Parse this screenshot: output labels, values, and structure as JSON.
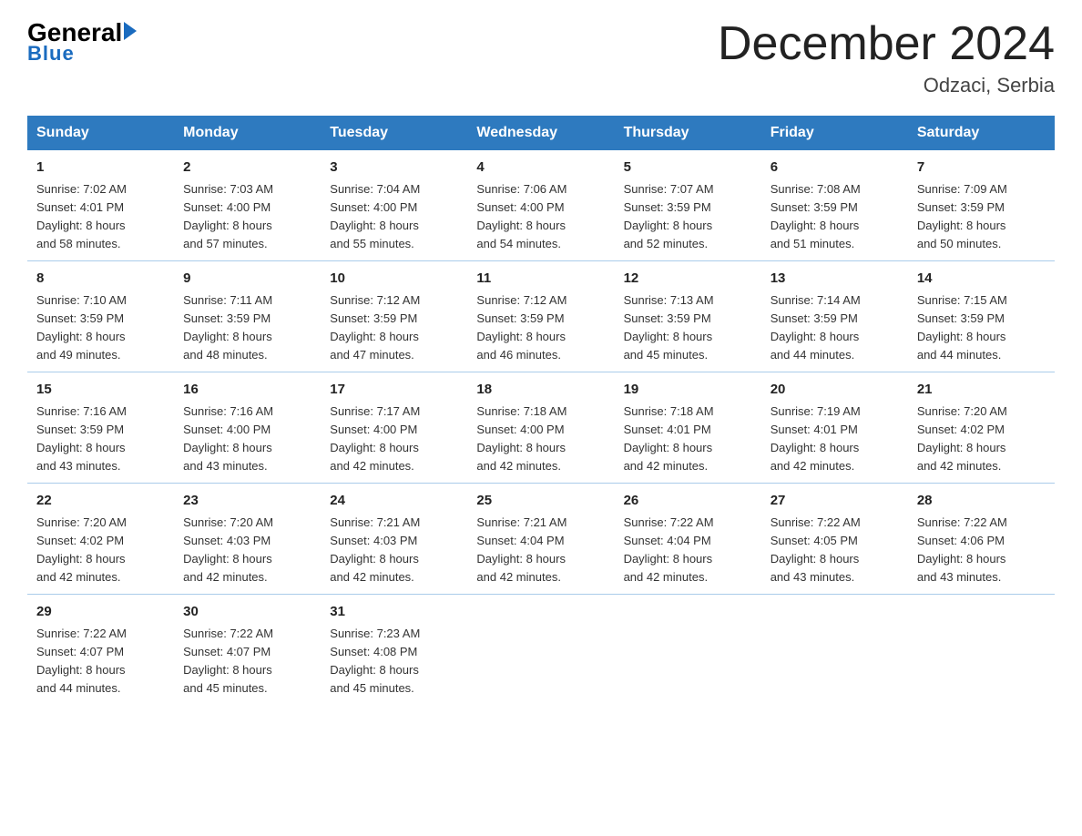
{
  "logo": {
    "general": "General",
    "blue": "Blue",
    "underline": "Blue"
  },
  "title": "December 2024",
  "subtitle": "Odzaci, Serbia",
  "header_days": [
    "Sunday",
    "Monday",
    "Tuesday",
    "Wednesday",
    "Thursday",
    "Friday",
    "Saturday"
  ],
  "weeks": [
    [
      {
        "num": "1",
        "info": "Sunrise: 7:02 AM\nSunset: 4:01 PM\nDaylight: 8 hours\nand 58 minutes."
      },
      {
        "num": "2",
        "info": "Sunrise: 7:03 AM\nSunset: 4:00 PM\nDaylight: 8 hours\nand 57 minutes."
      },
      {
        "num": "3",
        "info": "Sunrise: 7:04 AM\nSunset: 4:00 PM\nDaylight: 8 hours\nand 55 minutes."
      },
      {
        "num": "4",
        "info": "Sunrise: 7:06 AM\nSunset: 4:00 PM\nDaylight: 8 hours\nand 54 minutes."
      },
      {
        "num": "5",
        "info": "Sunrise: 7:07 AM\nSunset: 3:59 PM\nDaylight: 8 hours\nand 52 minutes."
      },
      {
        "num": "6",
        "info": "Sunrise: 7:08 AM\nSunset: 3:59 PM\nDaylight: 8 hours\nand 51 minutes."
      },
      {
        "num": "7",
        "info": "Sunrise: 7:09 AM\nSunset: 3:59 PM\nDaylight: 8 hours\nand 50 minutes."
      }
    ],
    [
      {
        "num": "8",
        "info": "Sunrise: 7:10 AM\nSunset: 3:59 PM\nDaylight: 8 hours\nand 49 minutes."
      },
      {
        "num": "9",
        "info": "Sunrise: 7:11 AM\nSunset: 3:59 PM\nDaylight: 8 hours\nand 48 minutes."
      },
      {
        "num": "10",
        "info": "Sunrise: 7:12 AM\nSunset: 3:59 PM\nDaylight: 8 hours\nand 47 minutes."
      },
      {
        "num": "11",
        "info": "Sunrise: 7:12 AM\nSunset: 3:59 PM\nDaylight: 8 hours\nand 46 minutes."
      },
      {
        "num": "12",
        "info": "Sunrise: 7:13 AM\nSunset: 3:59 PM\nDaylight: 8 hours\nand 45 minutes."
      },
      {
        "num": "13",
        "info": "Sunrise: 7:14 AM\nSunset: 3:59 PM\nDaylight: 8 hours\nand 44 minutes."
      },
      {
        "num": "14",
        "info": "Sunrise: 7:15 AM\nSunset: 3:59 PM\nDaylight: 8 hours\nand 44 minutes."
      }
    ],
    [
      {
        "num": "15",
        "info": "Sunrise: 7:16 AM\nSunset: 3:59 PM\nDaylight: 8 hours\nand 43 minutes."
      },
      {
        "num": "16",
        "info": "Sunrise: 7:16 AM\nSunset: 4:00 PM\nDaylight: 8 hours\nand 43 minutes."
      },
      {
        "num": "17",
        "info": "Sunrise: 7:17 AM\nSunset: 4:00 PM\nDaylight: 8 hours\nand 42 minutes."
      },
      {
        "num": "18",
        "info": "Sunrise: 7:18 AM\nSunset: 4:00 PM\nDaylight: 8 hours\nand 42 minutes."
      },
      {
        "num": "19",
        "info": "Sunrise: 7:18 AM\nSunset: 4:01 PM\nDaylight: 8 hours\nand 42 minutes."
      },
      {
        "num": "20",
        "info": "Sunrise: 7:19 AM\nSunset: 4:01 PM\nDaylight: 8 hours\nand 42 minutes."
      },
      {
        "num": "21",
        "info": "Sunrise: 7:20 AM\nSunset: 4:02 PM\nDaylight: 8 hours\nand 42 minutes."
      }
    ],
    [
      {
        "num": "22",
        "info": "Sunrise: 7:20 AM\nSunset: 4:02 PM\nDaylight: 8 hours\nand 42 minutes."
      },
      {
        "num": "23",
        "info": "Sunrise: 7:20 AM\nSunset: 4:03 PM\nDaylight: 8 hours\nand 42 minutes."
      },
      {
        "num": "24",
        "info": "Sunrise: 7:21 AM\nSunset: 4:03 PM\nDaylight: 8 hours\nand 42 minutes."
      },
      {
        "num": "25",
        "info": "Sunrise: 7:21 AM\nSunset: 4:04 PM\nDaylight: 8 hours\nand 42 minutes."
      },
      {
        "num": "26",
        "info": "Sunrise: 7:22 AM\nSunset: 4:04 PM\nDaylight: 8 hours\nand 42 minutes."
      },
      {
        "num": "27",
        "info": "Sunrise: 7:22 AM\nSunset: 4:05 PM\nDaylight: 8 hours\nand 43 minutes."
      },
      {
        "num": "28",
        "info": "Sunrise: 7:22 AM\nSunset: 4:06 PM\nDaylight: 8 hours\nand 43 minutes."
      }
    ],
    [
      {
        "num": "29",
        "info": "Sunrise: 7:22 AM\nSunset: 4:07 PM\nDaylight: 8 hours\nand 44 minutes."
      },
      {
        "num": "30",
        "info": "Sunrise: 7:22 AM\nSunset: 4:07 PM\nDaylight: 8 hours\nand 45 minutes."
      },
      {
        "num": "31",
        "info": "Sunrise: 7:23 AM\nSunset: 4:08 PM\nDaylight: 8 hours\nand 45 minutes."
      },
      null,
      null,
      null,
      null
    ]
  ]
}
